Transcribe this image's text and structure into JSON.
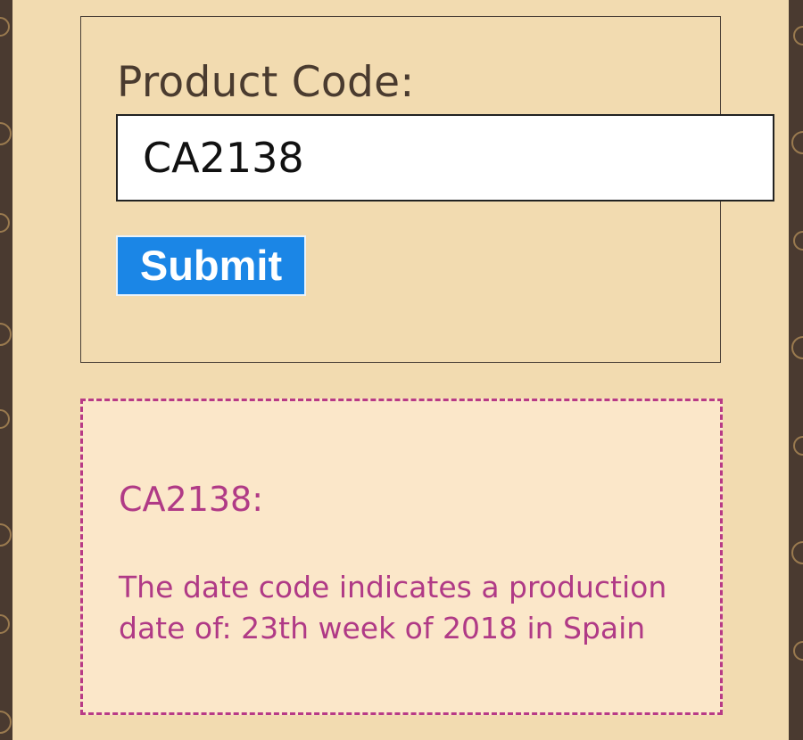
{
  "form": {
    "label": "Product Code:",
    "input_value": "CA2138",
    "submit_label": "Submit"
  },
  "result": {
    "title": "CA2138:",
    "text": "The date code indicates a production date of: 23th week of 2018 in Spain"
  },
  "colors": {
    "background": "#f2dbb0",
    "border_dark": "#4a3a30",
    "button": "#1b86e6",
    "result_text": "#b03a86",
    "result_bg": "#fbe7c9"
  }
}
